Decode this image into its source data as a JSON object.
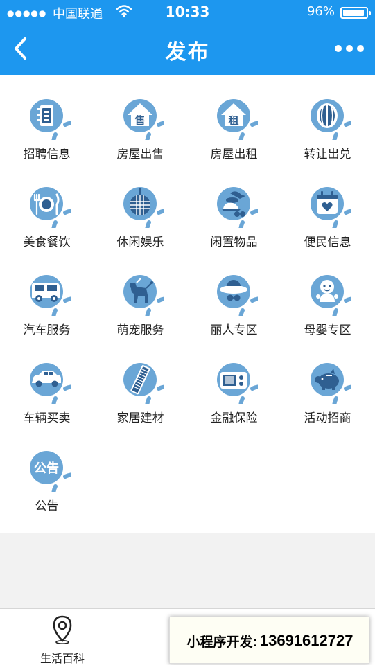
{
  "status_bar": {
    "signal": "●●●●●",
    "carrier": "中国联通",
    "time": "10:33",
    "battery": "96%"
  },
  "nav": {
    "title": "发布"
  },
  "categories": [
    {
      "label": "招聘信息",
      "icon": "recruit-icon"
    },
    {
      "label": "房屋出售",
      "icon": "house-sale-icon",
      "glyph": "售"
    },
    {
      "label": "房屋出租",
      "icon": "house-rent-icon",
      "glyph": "租"
    },
    {
      "label": "转让出兑",
      "icon": "transfer-icon"
    },
    {
      "label": "美食餐饮",
      "icon": "dining-icon"
    },
    {
      "label": "休闲娱乐",
      "icon": "disco-ball-icon"
    },
    {
      "label": "闲置物品",
      "icon": "secondhand-icon"
    },
    {
      "label": "便民信息",
      "icon": "calendar-heart-icon"
    },
    {
      "label": "汽车服务",
      "icon": "rv-camper-icon"
    },
    {
      "label": "萌宠服务",
      "icon": "pet-dog-icon"
    },
    {
      "label": "丽人专区",
      "icon": "beauty-hat-icon"
    },
    {
      "label": "母婴专区",
      "icon": "baby-icon"
    },
    {
      "label": "车辆买卖",
      "icon": "car-icon"
    },
    {
      "label": "家居建材",
      "icon": "building-material-icon"
    },
    {
      "label": "金融保险",
      "icon": "finance-radio-icon"
    },
    {
      "label": "活动招商",
      "icon": "piggy-bank-icon"
    },
    {
      "label": "公告",
      "icon": "notice-icon",
      "glyph": "公告"
    }
  ],
  "tabbar": {
    "items": [
      {
        "label": "生活百科",
        "icon": "location-pin-icon"
      }
    ]
  },
  "overlay": {
    "label": "小程序开发:",
    "phone": "13691612727"
  },
  "colors": {
    "brand_blue": "#1d97ef",
    "icon_blue": "#6aa6d6",
    "icon_dark": "#2f5f91"
  }
}
